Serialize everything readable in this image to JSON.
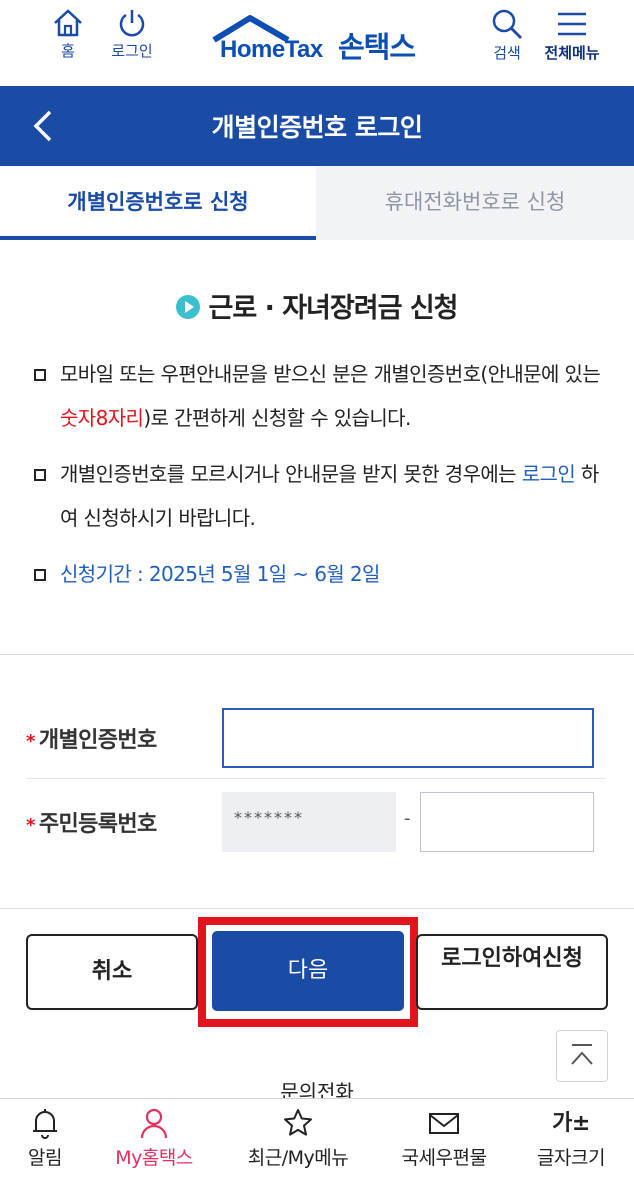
{
  "header": {
    "home_label": "홈",
    "login_label": "로그인",
    "logo_en": "HomeTax",
    "logo_ko": "손택스",
    "search_label": "검색",
    "menu_label": "전체메뉴"
  },
  "titlebar": {
    "title": "개별인증번호 로그인"
  },
  "tabs": [
    {
      "label": "개별인증번호로 신청",
      "active": true
    },
    {
      "label": "휴대전화번호로 신청",
      "active": false
    }
  ],
  "content": {
    "section_title": "근로 · 자녀장려금 신청",
    "bullet1": {
      "part1": "모바일 또는 우편안내문을 받으신 분은 개별인증번호(안내문에 있는 ",
      "highlight": "숫자8자리",
      "part2": ")로 간편하게 신청할 수 있습니다."
    },
    "bullet2": {
      "part1": "개별인증번호를 모르시거나 안내문을 받지 못한 경우에는 ",
      "link": "로그인",
      "part2": " 하여 신청하시기 바랍니다."
    },
    "bullet3": {
      "text": "신청기간 : 2025년 5월 1일 ~ 6월 2일"
    }
  },
  "form": {
    "cert_label": "개별인증번호",
    "cert_value": "",
    "rrn_label": "주민등록번호",
    "rrn_front_masked": "*******",
    "rrn_dash": "-",
    "rrn_back_value": ""
  },
  "buttons": {
    "cancel": "취소",
    "next": "다음",
    "login_apply": "로그인하여신청"
  },
  "inquiry_label": "문의전화",
  "bottom_nav": [
    {
      "label": "알림",
      "icon": "bell-icon"
    },
    {
      "label": "My홈택스",
      "icon": "person-icon"
    },
    {
      "label": "최근/My메뉴",
      "icon": "star-icon"
    },
    {
      "label": "국세우편물",
      "icon": "mail-icon"
    },
    {
      "label": "글자크기",
      "icon": "font-size-icon",
      "glyph": "가±"
    }
  ],
  "colors": {
    "primary": "#1a4ca6",
    "highlight_red": "#e2141c",
    "link_blue": "#1f5fbf",
    "active_nav": "#e0315f"
  }
}
